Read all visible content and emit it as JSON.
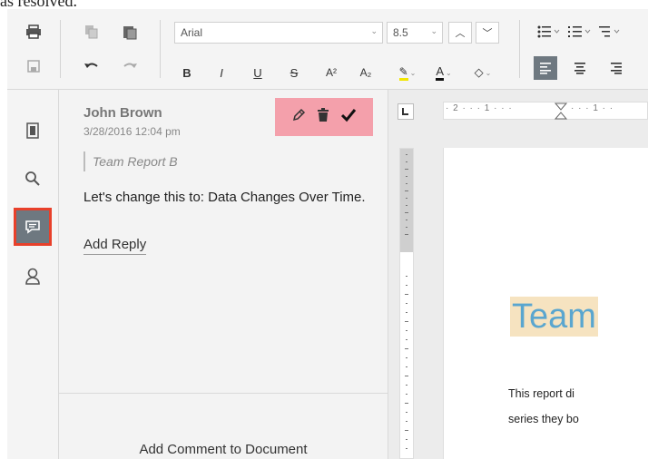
{
  "cut_text": "as resolved.",
  "toolbar": {
    "font_name": "Arial",
    "font_size": "8.5",
    "icons": [
      "print-icon",
      "save-icon",
      "copy-icon",
      "paste-icon",
      "undo-icon",
      "redo-icon",
      "increase-size-icon",
      "decrease-size-icon",
      "bullet-list-icon",
      "numbered-list-icon",
      "multilevel-list-icon"
    ],
    "format": {
      "bold": "B",
      "italic": "I",
      "underline": "U",
      "strikethrough": "S",
      "superscript": "A²",
      "subscript": "A₂",
      "font_color": "A"
    }
  },
  "sidebar": {
    "items": [
      {
        "icon": "document-icon",
        "active": false
      },
      {
        "icon": "search-icon",
        "active": false
      },
      {
        "icon": "comment-icon",
        "active": true
      },
      {
        "icon": "user-icon",
        "active": false
      }
    ]
  },
  "comment": {
    "author": "John Brown",
    "timestamp": "3/28/2016 12:04 pm",
    "quote": "Team Report B",
    "text": "Let's change this to: Data Changes Over Time.",
    "reply_label": "Add Reply",
    "action_icons": [
      "edit-icon",
      "delete-icon",
      "resolve-check-icon"
    ]
  },
  "add_comment_label": "Add Comment to Document",
  "ruler": {
    "marks": "· 2 · · · 1 · · ·",
    "marks_right": "· · · 1 · ·"
  },
  "document": {
    "title": "Team",
    "line1": "This report di",
    "line2": "series they bo"
  },
  "colors": {
    "active_sidebar": "#6e7880",
    "highlight_red": "#e8402a",
    "action_bar": "#f4a0ab",
    "title_text": "#5aa6cf",
    "title_highlight": "#f6e3c0"
  }
}
